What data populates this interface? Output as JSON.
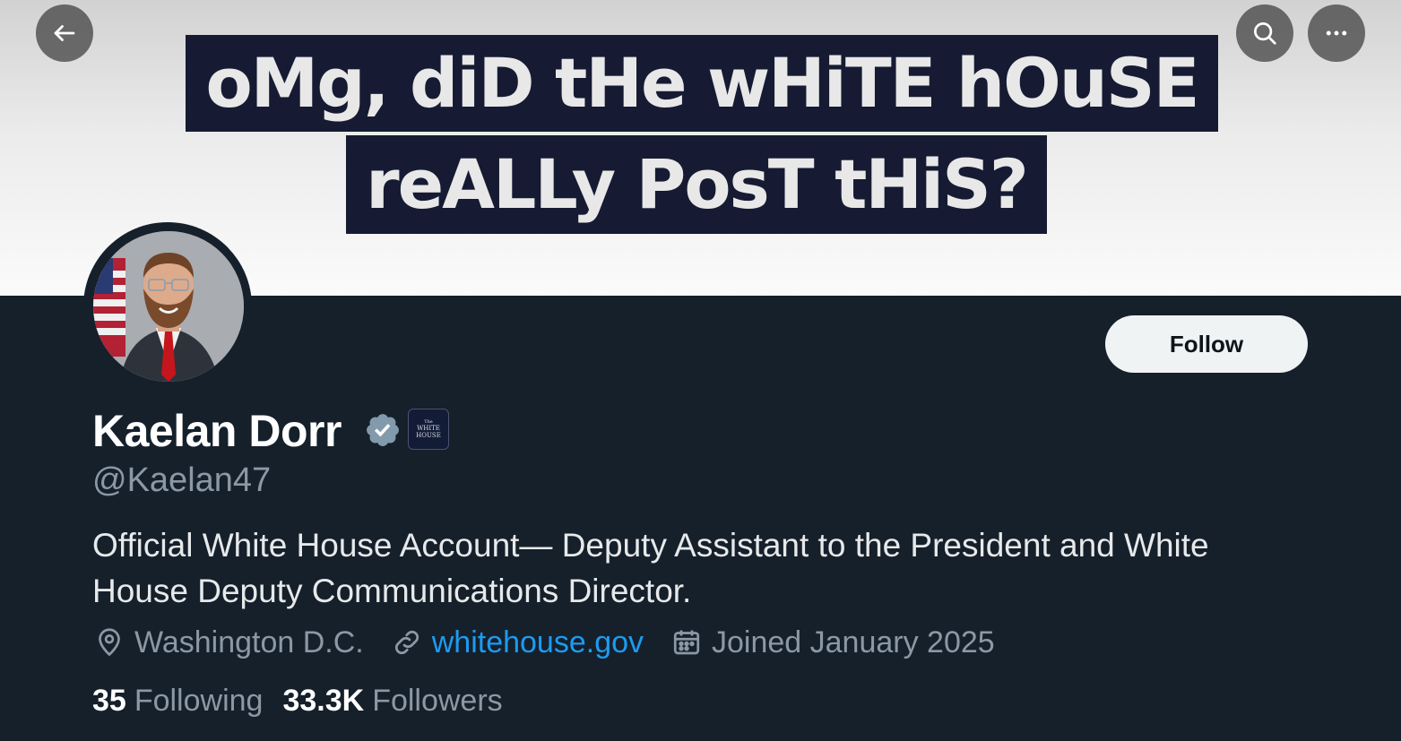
{
  "banner": {
    "line1": "oMg, diD tHe wHiTE hOuSE",
    "line2": "reALLy PosT tHiS?"
  },
  "nav": {
    "back_icon": "arrow-left-icon",
    "search_icon": "search-icon",
    "more_icon": "more-horizontal-icon"
  },
  "profile": {
    "name": "Kaelan Dorr",
    "handle": "@Kaelan47",
    "affiliation_badge": {
      "line1": "The",
      "line2": "WHITE",
      "line3": "HOUSE"
    },
    "bio": "Official White House Account— Deputy Assistant to the President and White House Deputy Communications Director.",
    "location": "Washington D.C.",
    "website": "whitehouse.gov",
    "joined": "Joined January 2025",
    "following_count": "35",
    "following_label": "Following",
    "followers_count": "33.3K",
    "followers_label": "Followers"
  },
  "actions": {
    "follow_label": "Follow"
  },
  "colors": {
    "background": "#15202b",
    "accent": "#1d9bf0",
    "muted_text": "#8b98a5",
    "verified_badge": "#829aab"
  }
}
